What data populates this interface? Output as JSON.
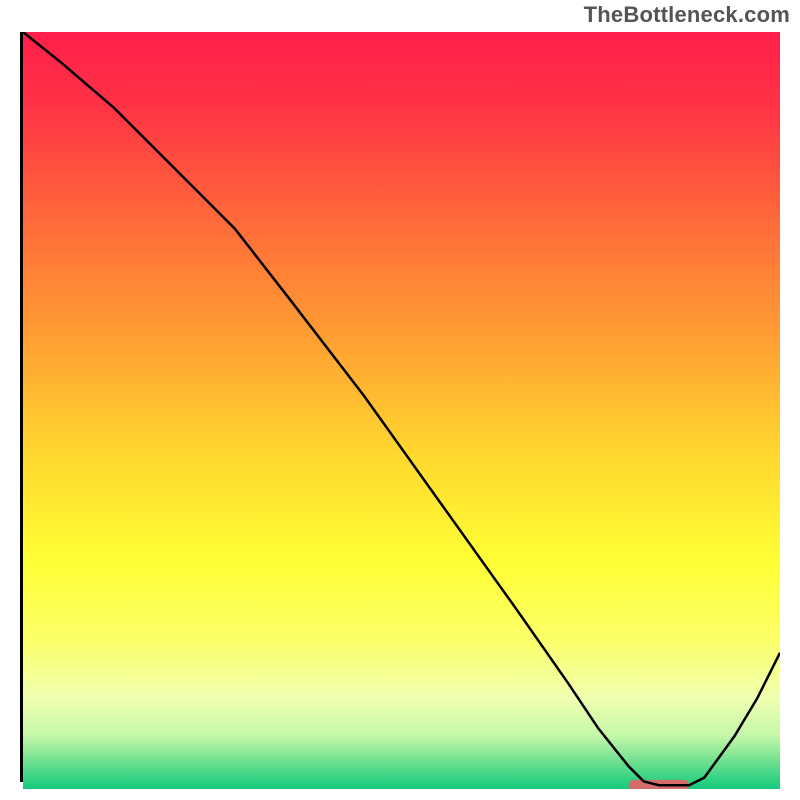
{
  "watermark": "TheBottleneck.com",
  "chart_data": {
    "type": "line",
    "title": "",
    "xlabel": "",
    "ylabel": "",
    "xlim": [
      0,
      100
    ],
    "ylim": [
      0,
      100
    ],
    "grid": false,
    "background_gradient": {
      "stops": [
        {
          "offset": 0.0,
          "color": "#ff1f4b"
        },
        {
          "offset": 0.1,
          "color": "#ff3345"
        },
        {
          "offset": 0.25,
          "color": "#ff6a3a"
        },
        {
          "offset": 0.4,
          "color": "#ff9d33"
        },
        {
          "offset": 0.55,
          "color": "#ffd52f"
        },
        {
          "offset": 0.7,
          "color": "#ffff35"
        },
        {
          "offset": 0.8,
          "color": "#fbff66"
        },
        {
          "offset": 0.88,
          "color": "#f0ffb0"
        },
        {
          "offset": 0.93,
          "color": "#c4f7a8"
        },
        {
          "offset": 0.965,
          "color": "#6bdf8f"
        },
        {
          "offset": 1.0,
          "color": "#14c97d"
        }
      ]
    },
    "series": [
      {
        "name": "bottleneck-curve",
        "color": "#000000",
        "width": 2.5,
        "x": [
          0,
          5,
          12,
          20,
          24,
          28,
          35,
          45,
          55,
          65,
          72,
          76,
          80,
          82,
          84,
          86,
          88,
          90,
          94,
          97,
          100
        ],
        "y": [
          100,
          96,
          90,
          82,
          78,
          74,
          65,
          52,
          38,
          24,
          14,
          8,
          3,
          1,
          0.5,
          0.5,
          0.5,
          1.5,
          7,
          12,
          18
        ]
      }
    ],
    "marker": {
      "name": "optimal-range-marker",
      "color": "#d66b6b",
      "x_start": 80,
      "x_end": 88,
      "y": 0.5,
      "thickness_pct": 1.4
    }
  }
}
